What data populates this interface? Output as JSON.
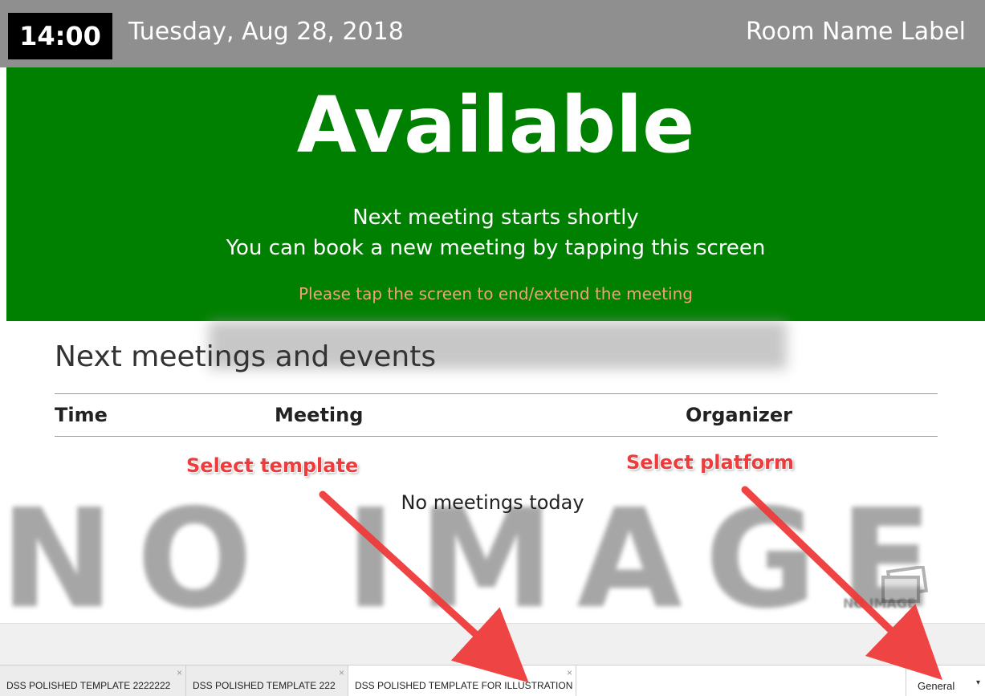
{
  "header": {
    "time": "14:00",
    "date": "Tuesday, Aug 28, 2018",
    "room_name": "Room Name Label"
  },
  "status": {
    "title": "Available",
    "message_line1": "Next meeting starts shortly",
    "message_line2": "You can book a new meeting by tapping this screen",
    "hint": "Please tap the screen to end/extend the meeting",
    "colors": {
      "background": "#008000",
      "hint": "#f2a27a"
    }
  },
  "events": {
    "title": "Next meetings and events",
    "columns": [
      "Time",
      "Meeting",
      "Organizer"
    ],
    "empty_message": "No meetings today"
  },
  "watermark": {
    "large_text": "NO IMAGE",
    "small_text": "NO IMAGE",
    "icon": "image-placeholder-icon"
  },
  "annotations": {
    "select_template": "Select template",
    "select_platform": "Select platform",
    "color": "#ef3b3b"
  },
  "tabs": [
    {
      "label": "DSS POLISHED TEMPLATE 2222222",
      "active": false
    },
    {
      "label": "DSS POLISHED TEMPLATE 222",
      "active": false
    },
    {
      "label": "DSS POLISHED TEMPLATE FOR ILLUSTRATION",
      "active": true
    }
  ],
  "tab_close_glyph": "×",
  "platform_select": {
    "value": "General",
    "caret": "▾"
  }
}
